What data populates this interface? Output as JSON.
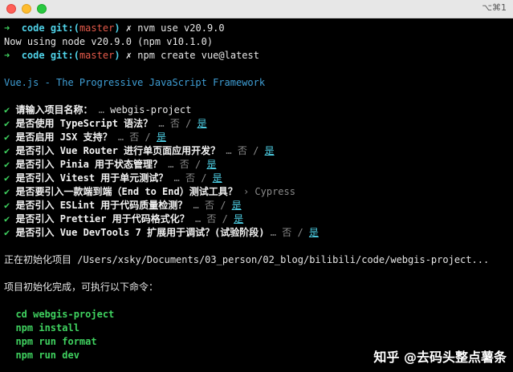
{
  "window": {
    "shortcut": "⌥⌘1"
  },
  "prompt": {
    "arrow": "➜",
    "dir": "code",
    "git": "git:(",
    "branch": "master",
    "close": ")",
    "dirty": "✗"
  },
  "commands": [
    {
      "cmd": "nvm use v20.9.0"
    },
    {
      "cmd": "npm create vue@latest"
    }
  ],
  "output_nvm": "Now using node v20.9.0 (npm v10.1.0)",
  "banner": "Vue.js - The Progressive JavaScript Framework",
  "questions": [
    {
      "label": "请输入项目名称：",
      "sep": " … ",
      "answer": "webgis-project",
      "type": "text"
    },
    {
      "label": "是否使用 TypeScript 语法？",
      "sep": " … ",
      "no": "否",
      "slash": " / ",
      "yes": "是",
      "type": "toggle"
    },
    {
      "label": "是否启用 JSX 支持？",
      "sep": " … ",
      "no": "否",
      "slash": " / ",
      "yes": "是",
      "type": "toggle"
    },
    {
      "label": "是否引入 Vue Router 进行单页面应用开发？",
      "sep": " … ",
      "no": "否",
      "slash": " / ",
      "yes": "是",
      "type": "toggle"
    },
    {
      "label": "是否引入 Pinia 用于状态管理？",
      "sep": " … ",
      "no": "否",
      "slash": " / ",
      "yes": "是",
      "type": "toggle"
    },
    {
      "label": "是否引入 Vitest 用于单元测试？",
      "sep": " … ",
      "no": "否",
      "slash": " / ",
      "yes": "是",
      "type": "toggle"
    },
    {
      "label": "是否要引入一款端到端（End to End）测试工具？",
      "sep": " › ",
      "answer": "Cypress",
      "type": "select"
    },
    {
      "label": "是否引入 ESLint 用于代码质量检测？",
      "sep": " … ",
      "no": "否",
      "slash": " / ",
      "yes": "是",
      "type": "toggle"
    },
    {
      "label": "是否引入 Prettier 用于代码格式化？",
      "sep": " … ",
      "no": "否",
      "slash": " / ",
      "yes": "是",
      "type": "toggle"
    },
    {
      "label": "是否引入 Vue DevTools 7 扩展用于调试？(试验阶段)",
      "sep": " … ",
      "no": "否",
      "slash": " / ",
      "yes": "是",
      "type": "toggle"
    }
  ],
  "check": "✔",
  "init": "正在初始化项目 /Users/xsky/Documents/03_person/02_blog/bilibili/code/webgis-project...",
  "done": "项目初始化完成，可执行以下命令：",
  "next": [
    "cd webgis-project",
    "npm install",
    "npm run format",
    "npm run dev"
  ],
  "watermark": "知乎 @去码头整点薯条"
}
